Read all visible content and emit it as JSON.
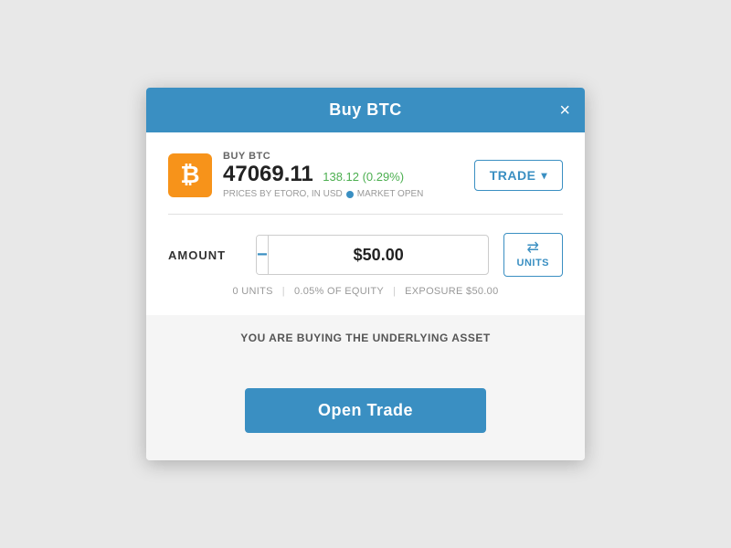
{
  "modal": {
    "title": "Buy BTC",
    "close_label": "×"
  },
  "asset": {
    "label": "BUY BTC",
    "price": "47069.11",
    "change": "138.12 (0.29%)",
    "prices_by": "PRICES BY ETORO, IN USD",
    "market_status": "MARKET OPEN",
    "btc_symbol": "₿"
  },
  "trade_button": {
    "label": "TRADE",
    "arrow": "▾"
  },
  "amount_section": {
    "label": "AMOUNT",
    "minus": "−",
    "plus": "+",
    "value": "$50.00"
  },
  "units_button": {
    "arrows": "⇄",
    "label": "UNITS"
  },
  "meta": {
    "units": "0 UNITS",
    "equity": "0.05% OF EQUITY",
    "exposure": "EXPOSURE $50.00"
  },
  "underlying_msg": "YOU ARE BUYING THE UNDERLYING ASSET",
  "footer": {
    "open_trade": "Open Trade"
  }
}
